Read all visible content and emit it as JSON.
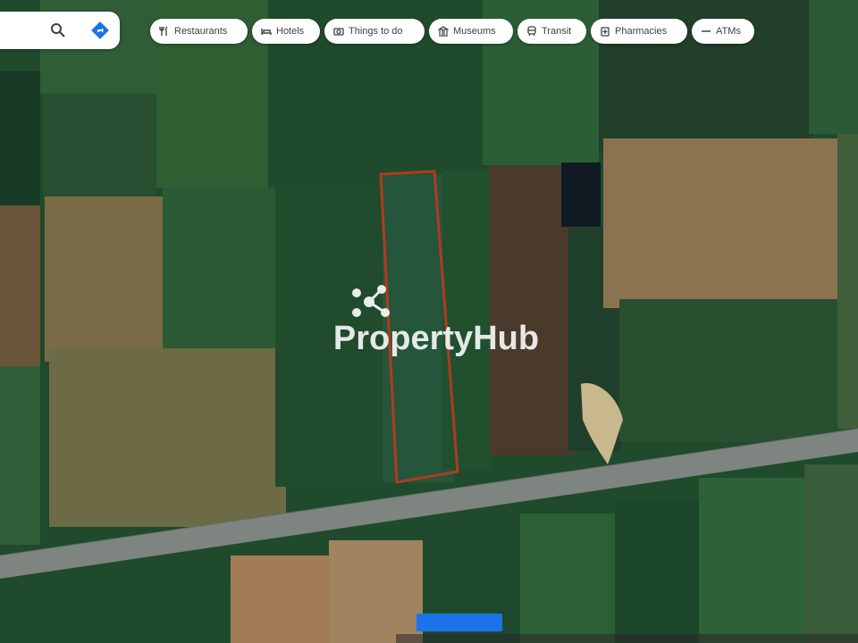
{
  "search": {
    "search_icon": "search-icon",
    "directions_icon": "directions-icon"
  },
  "chips": [
    {
      "name": "chip-restaurants",
      "icon": "restaurant-icon",
      "label": "Restaurants"
    },
    {
      "name": "chip-hotels",
      "icon": "hotel-icon",
      "label": "Hotels"
    },
    {
      "name": "chip-things-to-do",
      "icon": "camera-icon",
      "label": "Things to do"
    },
    {
      "name": "chip-museums",
      "icon": "museum-icon",
      "label": "Museums"
    },
    {
      "name": "chip-transit",
      "icon": "transit-icon",
      "label": "Transit"
    },
    {
      "name": "chip-pharmacies",
      "icon": "pharmacy-icon",
      "label": "Pharmacies"
    },
    {
      "name": "chip-atms",
      "icon": "atm-icon",
      "label": "ATMs"
    }
  ],
  "watermark": {
    "brand": "PropertyHub",
    "logo": "propertyhub-logo-icon"
  },
  "map": {
    "type": "satellite",
    "highlight_color": "#b03a22",
    "accent_color": "#1a73e8"
  }
}
